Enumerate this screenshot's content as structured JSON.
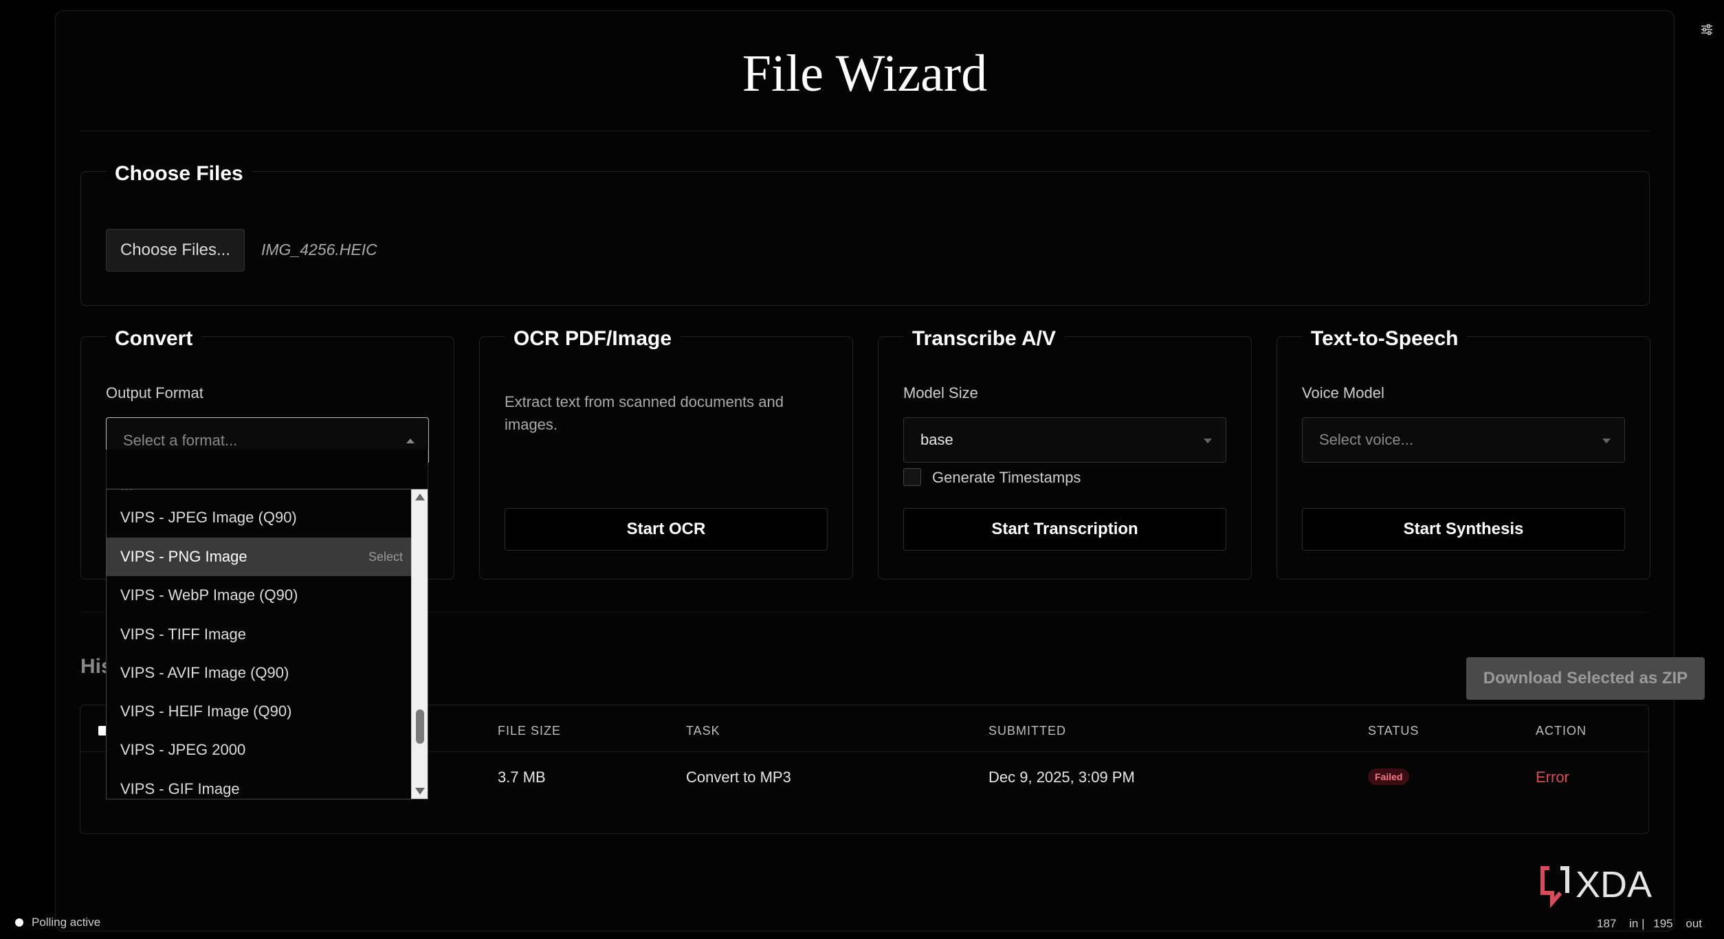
{
  "app": {
    "title": "File Wizard"
  },
  "choose_files": {
    "legend": "Choose Files",
    "button_label": "Choose Files...",
    "selected_file": "IMG_4256.HEIC"
  },
  "convert": {
    "legend": "Convert",
    "output_label": "Output Format",
    "placeholder": "Select a format...",
    "dropdown": {
      "partial_top": "...",
      "items": [
        {
          "label": "VIPS - JPEG Image (Q90)",
          "highlighted": false
        },
        {
          "label": "VIPS - PNG Image",
          "highlighted": true,
          "hint": "Select"
        },
        {
          "label": "VIPS - WebP Image (Q90)",
          "highlighted": false
        },
        {
          "label": "VIPS - TIFF Image",
          "highlighted": false
        },
        {
          "label": "VIPS - AVIF Image (Q90)",
          "highlighted": false
        },
        {
          "label": "VIPS - HEIF Image (Q90)",
          "highlighted": false
        },
        {
          "label": "VIPS - JPEG 2000",
          "highlighted": false
        },
        {
          "label": "VIPS - GIF Image",
          "highlighted": false
        }
      ]
    }
  },
  "ocr": {
    "legend": "OCR PDF/Image",
    "description": "Extract text from scanned documents and images.",
    "button_label": "Start OCR"
  },
  "transcribe": {
    "legend": "Transcribe A/V",
    "model_label": "Model Size",
    "model_value": "base",
    "timestamps_label": "Generate Timestamps",
    "timestamps_checked": false,
    "button_label": "Start Transcription"
  },
  "tts": {
    "legend": "Text-to-Speech",
    "voice_label": "Voice Model",
    "placeholder": "Select voice...",
    "button_label": "Start Synthesis"
  },
  "history": {
    "title_visible": "His",
    "zip_button": "Download Selected as ZIP",
    "columns": [
      "FILE SIZE",
      "TASK",
      "SUBMITTED",
      "STATUS",
      "ACTION"
    ],
    "rows": [
      {
        "file_size": "3.7 MB",
        "task": "Convert to MP3",
        "submitted": "Dec 9, 2025, 3:09 PM",
        "status": "Failed",
        "action": "Error"
      }
    ]
  },
  "footer": {
    "status": "Polling active",
    "counter_in": "187",
    "counter_in_label": "in |",
    "counter_out": "195",
    "counter_out_label": "out"
  },
  "branding": {
    "watermark": "XDA"
  },
  "colors": {
    "accent_error": "#e0475a",
    "badge_bg": "#3a0d12",
    "badge_fg": "#f07a8a"
  },
  "icons": {
    "settings": "sliders-icon"
  }
}
